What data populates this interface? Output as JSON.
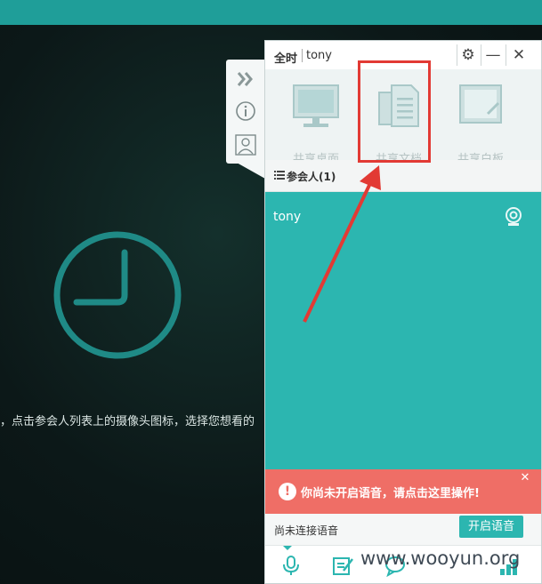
{
  "window": {
    "brand": "全时",
    "user": "tony"
  },
  "toolbar": {
    "items": [
      {
        "label": "共享桌面",
        "icon": "monitor-icon"
      },
      {
        "label": "共享文档",
        "icon": "documents-icon"
      },
      {
        "label": "共享白板",
        "icon": "whiteboard-icon"
      }
    ]
  },
  "participants_tab": {
    "label": "参会人(1)"
  },
  "participants": [
    {
      "name": "tony",
      "icon": "webcam-icon"
    }
  ],
  "warning": {
    "text": "你尚未开启语音，请点击这里操作!"
  },
  "status": {
    "text": "尚未连接语音",
    "voice_button": "开启语音"
  },
  "background": {
    "hint": "，点击参会人列表上的摄像头图标，选择您想看的"
  },
  "watermark": "www.wooyun.org",
  "colors": {
    "accent": "#2cb6b0",
    "warning": "#ef6e66",
    "annotation": "#e23a34"
  }
}
